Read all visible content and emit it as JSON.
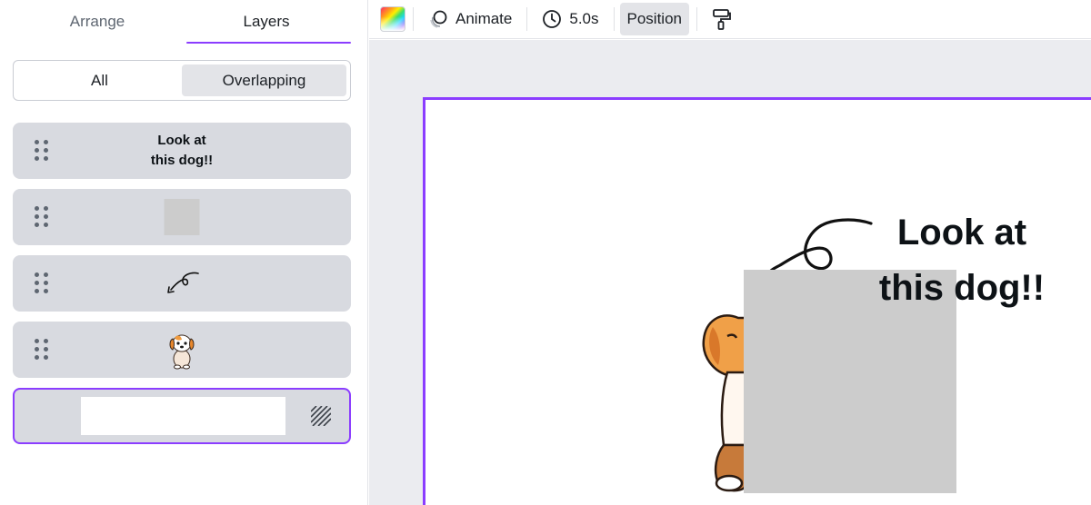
{
  "panel": {
    "tabs": [
      {
        "label": "Arrange",
        "active": false
      },
      {
        "label": "Layers",
        "active": true
      }
    ],
    "filter": {
      "options": [
        {
          "label": "All",
          "active": false
        },
        {
          "label": "Overlapping",
          "active": true
        }
      ]
    },
    "layers": [
      {
        "type": "text",
        "lines": [
          "Look at",
          "this dog!!"
        ]
      },
      {
        "type": "shape",
        "icon": "gray-square"
      },
      {
        "type": "graphic",
        "icon": "curly-arrow-icon"
      },
      {
        "type": "image",
        "icon": "dog-sticker"
      },
      {
        "type": "background",
        "icon": "hatched-lock-icon",
        "selected": true
      }
    ]
  },
  "toolbar": {
    "color_icon": "color-swatch",
    "animate_label": "Animate",
    "duration_label": "5.0s",
    "position_label": "Position",
    "format_painter_icon": "paint-roller-icon"
  },
  "canvas": {
    "text_lines": [
      "Look at",
      "this dog!!"
    ],
    "accent": "#8b3dff",
    "shape_color": "#cccccc",
    "background": "#ebecf0"
  }
}
